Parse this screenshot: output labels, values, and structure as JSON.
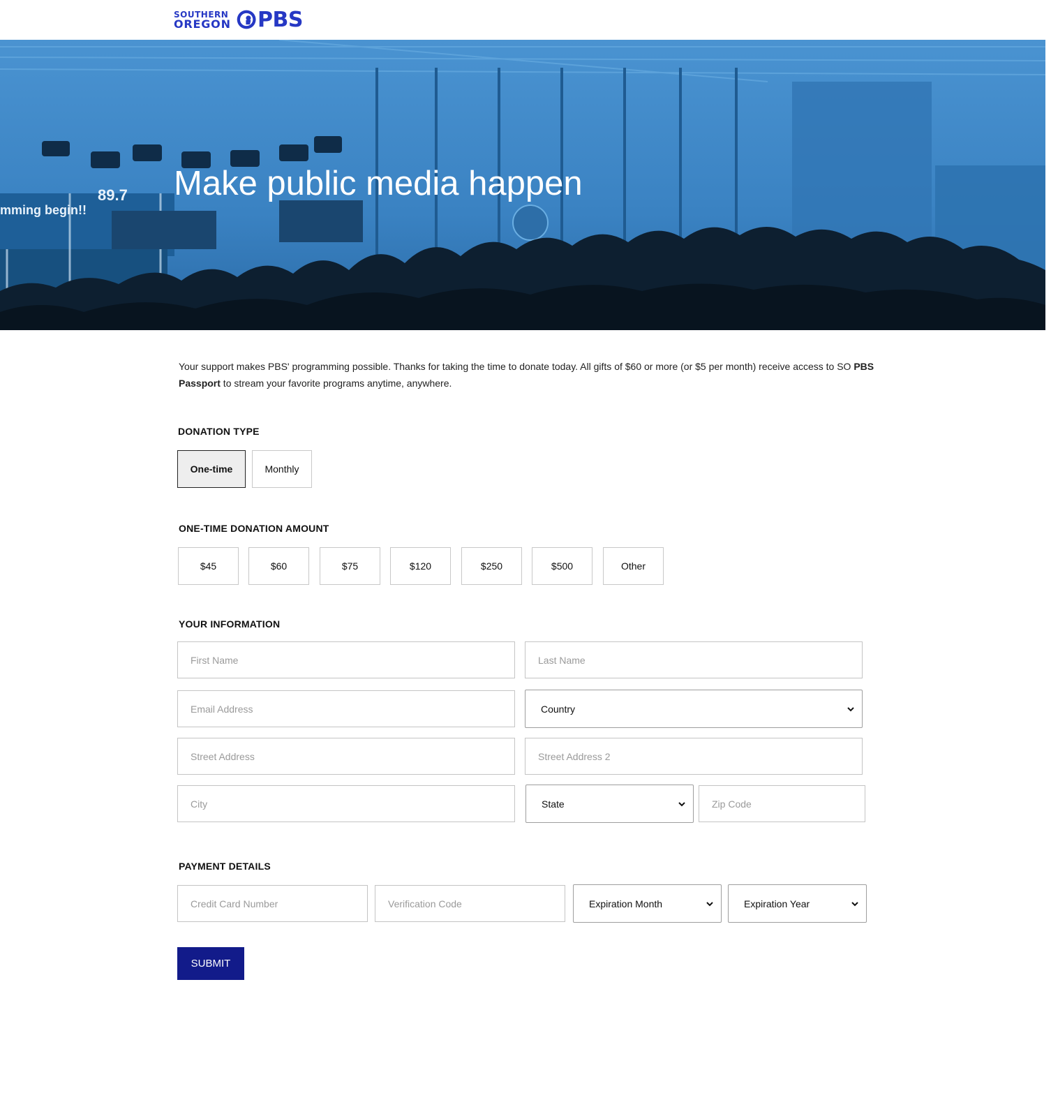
{
  "header": {
    "logo_line1": "SOUTHERN",
    "logo_line2": "OREGON",
    "logo_brand": "PBS"
  },
  "hero": {
    "title": "Make public media happen",
    "photo_sign_text": "mming begin!!",
    "photo_sign_number": "89.7"
  },
  "intro": {
    "text_before": "Your support makes PBS' programming possible. Thanks for taking the time to donate today. All gifts of $60 or more (or $5 per month) receive access to SO ",
    "bold": "PBS Passport",
    "text_after": " to stream your favorite programs anytime, anywhere."
  },
  "donation_type": {
    "label": "DONATION TYPE",
    "options": [
      "One-time",
      "Monthly"
    ],
    "selected": "One-time"
  },
  "amount": {
    "label": "ONE-TIME DONATION AMOUNT",
    "options": [
      "$45",
      "$60",
      "$75",
      "$120",
      "$250",
      "$500",
      "Other"
    ]
  },
  "info": {
    "label": "YOUR INFORMATION",
    "first_name": "First Name",
    "last_name": "Last Name",
    "email": "Email Address",
    "country": "Country",
    "street": "Street Address",
    "street2": "Street Address 2",
    "city": "City",
    "state": "State",
    "zip": "Zip Code"
  },
  "payment": {
    "label": "PAYMENT DETAILS",
    "card": "Credit Card Number",
    "cvv": "Verification Code",
    "exp_month": "Expiration Month",
    "exp_year": "Expiration Year"
  },
  "submit_label": "SUBMIT",
  "colors": {
    "brand_blue": "#2638c4",
    "submit_navy": "#121b8a",
    "hero_blue": "#3b86c6"
  }
}
